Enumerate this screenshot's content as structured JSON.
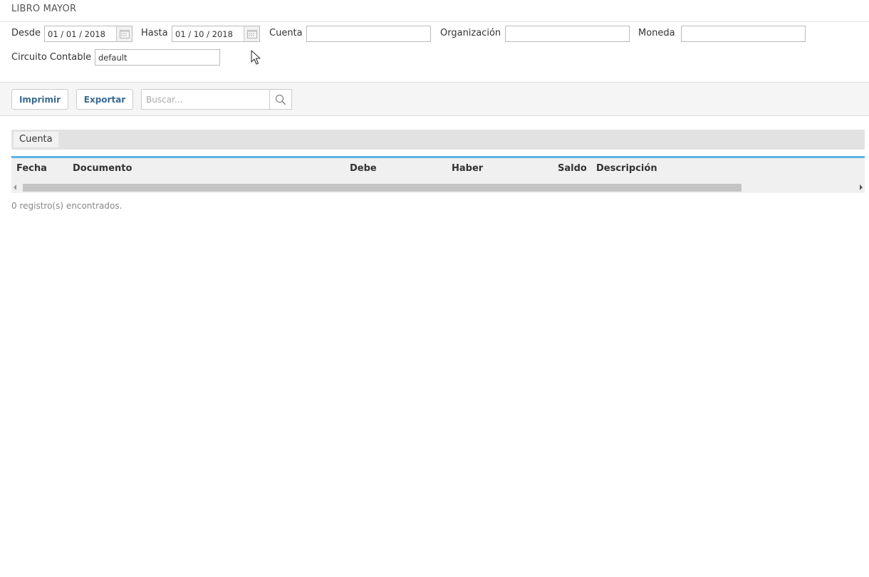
{
  "page": {
    "title": "LIBRO MAYOR"
  },
  "filters": {
    "desde_label": "Desde",
    "desde_value": "01 / 01 /  2018",
    "hasta_label": "Hasta",
    "hasta_value": "01 / 10 /  2018",
    "cuenta_label": "Cuenta",
    "cuenta_value": "",
    "organizacion_label": "Organización",
    "organizacion_value": "",
    "moneda_label": "Moneda",
    "moneda_value": "",
    "circuito_label": "Circuito Contable",
    "circuito_value": "default",
    "calendar_icon": "calendar-icon"
  },
  "toolbar": {
    "print_label": "Imprimir",
    "export_label": "Exportar",
    "search_placeholder": "Buscar...",
    "search_icon": "magnifier-icon"
  },
  "grid": {
    "group_label": "Cuenta",
    "columns": [
      "Fecha",
      "Documento",
      "Debe",
      "Haber",
      "Saldo",
      "Descripción"
    ],
    "accent_color": "#5bb4e5"
  },
  "status": {
    "records_text": "0 registro(s) encontrados."
  },
  "colors": {
    "button_text": "#3a6a91",
    "toolbar_bg": "#f5f5f5"
  }
}
